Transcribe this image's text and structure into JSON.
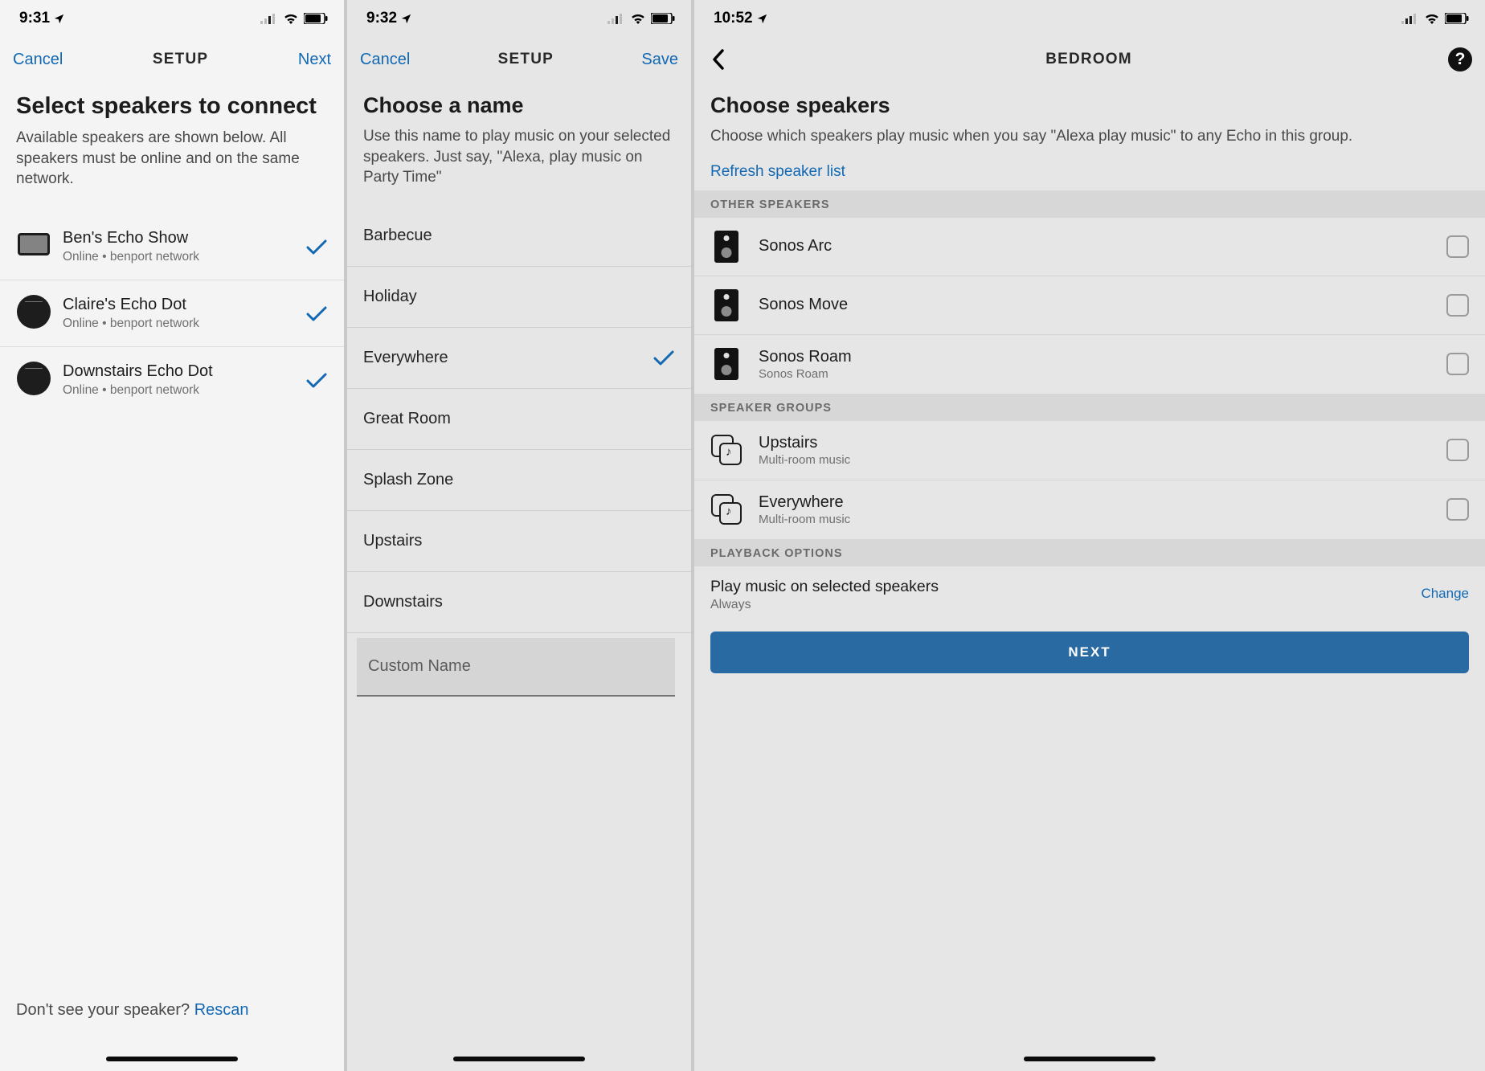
{
  "s1": {
    "status_time": "9:31",
    "nav": {
      "left": "Cancel",
      "title": "SETUP",
      "right": "Next"
    },
    "heading": "Select speakers to connect",
    "sub": "Available speakers are shown below. All speakers must be online and on the same network.",
    "speakers": [
      {
        "name": "Ben's Echo Show",
        "sub": "Online • benport network",
        "icon": "show",
        "checked": true
      },
      {
        "name": "Claire's Echo Dot",
        "sub": "Online • benport network",
        "icon": "dot",
        "checked": true
      },
      {
        "name": "Downstairs Echo Dot",
        "sub": "Online • benport network",
        "icon": "dot",
        "checked": true
      }
    ],
    "footer_text": "Don't see your speaker? ",
    "footer_link": "Rescan"
  },
  "s2": {
    "status_time": "9:32",
    "nav": {
      "left": "Cancel",
      "title": "SETUP",
      "right": "Save"
    },
    "heading": "Choose a name",
    "sub": "Use this name to play music on your selected speakers. Just say, \"Alexa, play music on Party Time\"",
    "names": [
      {
        "label": "Barbecue",
        "selected": false
      },
      {
        "label": "Holiday",
        "selected": false
      },
      {
        "label": "Everywhere",
        "selected": true
      },
      {
        "label": "Great Room",
        "selected": false
      },
      {
        "label": "Splash Zone",
        "selected": false
      },
      {
        "label": "Upstairs",
        "selected": false
      },
      {
        "label": "Downstairs",
        "selected": false
      }
    ],
    "custom_placeholder": "Custom Name"
  },
  "s3": {
    "status_time": "10:52",
    "nav": {
      "title": "BEDROOM"
    },
    "heading": "Choose speakers",
    "sub": "Choose which speakers play music when you say \"Alexa play music\" to any Echo in this group.",
    "refresh": "Refresh speaker list",
    "section1": "OTHER SPEAKERS",
    "other_speakers": [
      {
        "name": "Sonos Arc",
        "sub": ""
      },
      {
        "name": "Sonos Move",
        "sub": ""
      },
      {
        "name": "Sonos Roam",
        "sub": "Sonos Roam"
      }
    ],
    "section2": "SPEAKER GROUPS",
    "groups": [
      {
        "name": "Upstairs",
        "sub": "Multi-room music"
      },
      {
        "name": "Everywhere",
        "sub": "Multi-room music"
      }
    ],
    "section3": "PLAYBACK OPTIONS",
    "playback": {
      "title": "Play music on selected speakers",
      "value": "Always",
      "change": "Change"
    },
    "next_btn": "NEXT"
  }
}
